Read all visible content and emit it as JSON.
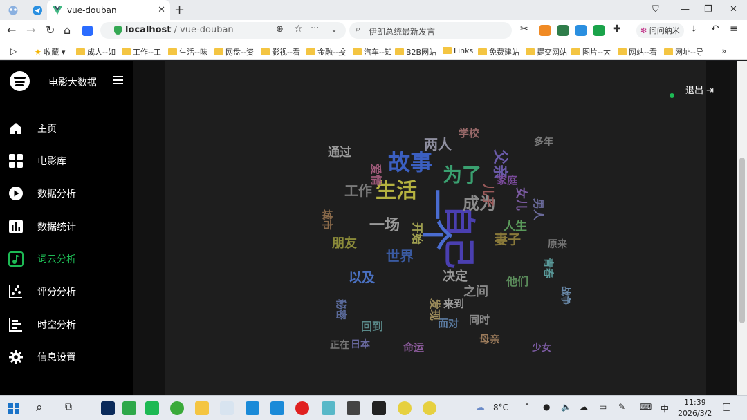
{
  "browser": {
    "tab_title": "vue-douban",
    "url_host": "localhost",
    "url_path": "/ vue-douban",
    "search_text": "伊朗总统最新发言",
    "ext_label": "问问纳米"
  },
  "bookmarks": [
    "收藏",
    "成人--如",
    "工作--工",
    "生活--味",
    "网盘--资",
    "影视--看",
    "金融--投",
    "汽车--知",
    "B2B网站",
    "Links",
    "免费建站",
    "提交网站",
    "图片--大",
    "网站--看",
    "网址--导"
  ],
  "app": {
    "title": "电影大数据",
    "logout": "退出",
    "menu": [
      {
        "label": "主页",
        "icon": "home-icon",
        "active": false
      },
      {
        "label": "电影库",
        "icon": "grid-icon",
        "active": false
      },
      {
        "label": "数据分析",
        "icon": "play-circle-icon",
        "active": false
      },
      {
        "label": "数据统计",
        "icon": "bar-chart-icon",
        "active": false
      },
      {
        "label": "词云分析",
        "icon": "music-note-icon",
        "active": true
      },
      {
        "label": "评分分析",
        "icon": "scatter-icon",
        "active": false
      },
      {
        "label": "时空分析",
        "icon": "timeline-icon",
        "active": false
      },
      {
        "label": "信息设置",
        "icon": "gear-icon",
        "active": false
      }
    ]
  },
  "wordcloud": [
    {
      "text": "故事",
      "color": "#3b5fc0"
    },
    {
      "text": "自己",
      "color": "#4a3fb0"
    },
    {
      "text": "生活",
      "color": "#b5b240"
    },
    {
      "text": "成为",
      "color": "#8a8a8a"
    },
    {
      "text": "两人",
      "color": "#8f8fa0"
    },
    {
      "text": "一个",
      "color": "#4a6cd0"
    },
    {
      "text": "为了",
      "color": "#3aa070"
    },
    {
      "text": "父亲",
      "color": "#6a5aa8"
    },
    {
      "text": "一场",
      "color": "#9a9a9a"
    },
    {
      "text": "通过",
      "color": "#9b9b9b"
    },
    {
      "text": "工作",
      "color": "#7a7a7a"
    },
    {
      "text": "人生",
      "color": "#5a9a5a"
    },
    {
      "text": "世界",
      "color": "#3a5aa0"
    },
    {
      "text": "以及",
      "color": "#4a70c0"
    },
    {
      "text": "决定",
      "color": "#9a9a9a"
    },
    {
      "text": "朋友",
      "color": "#8b8b3a"
    },
    {
      "text": "之间",
      "color": "#888888"
    },
    {
      "text": "妻子",
      "color": "#8a7a3a"
    },
    {
      "text": "原来",
      "color": "#777777"
    },
    {
      "text": "日本",
      "color": "#6a6aa0"
    },
    {
      "text": "正在",
      "color": "#777777"
    },
    {
      "text": "学校",
      "color": "#9a6a6a"
    },
    {
      "text": "女儿",
      "color": "#7a5aa0"
    },
    {
      "text": "开始",
      "color": "#a0a050"
    },
    {
      "text": "来到",
      "color": "#a0a0a0"
    },
    {
      "text": "家庭",
      "color": "#7a4a9a"
    },
    {
      "text": "多年",
      "color": "#7a7a7a"
    },
    {
      "text": "少女",
      "color": "#7a5aa0"
    },
    {
      "text": "面对",
      "color": "#5a7aa0"
    },
    {
      "text": "同时",
      "color": "#8a8a8a"
    },
    {
      "text": "他们",
      "color": "#5a8a5a"
    },
    {
      "text": "儿子",
      "color": "#9a5a5a"
    },
    {
      "text": "男人",
      "color": "#6a6a9a"
    },
    {
      "text": "爱情",
      "color": "#a05a7a"
    },
    {
      "text": "青春",
      "color": "#5a9a9a"
    },
    {
      "text": "城市",
      "color": "#8a6a4a"
    },
    {
      "text": "战争",
      "color": "#6a8aaa"
    },
    {
      "text": "母亲",
      "color": "#9a7a5a"
    },
    {
      "text": "秘密",
      "color": "#5a6a9a"
    },
    {
      "text": "命运",
      "color": "#8a5a9a"
    },
    {
      "text": "回到",
      "color": "#5a8a8a"
    },
    {
      "text": "发现",
      "color": "#9a8a5a"
    }
  ],
  "taskbar": {
    "weather": "8°C",
    "time": "11:39",
    "date": "2026/3/2",
    "ime": "中"
  }
}
